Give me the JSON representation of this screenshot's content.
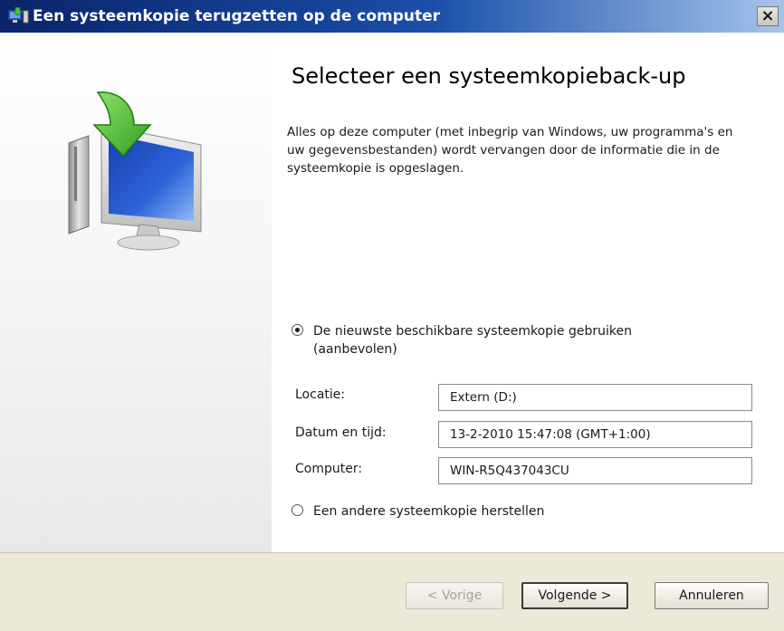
{
  "window": {
    "title": "Een systeemkopie terugzetten op de computer",
    "close_label": "×"
  },
  "main": {
    "heading": "Selecteer een systeemkopieback-up",
    "description": "Alles op deze computer (met inbegrip van Windows, uw programma's en uw gegevensbestanden) wordt vervangen door de informatie die in de systeemkopie is opgeslagen.",
    "options": {
      "latest": {
        "line1": "De nieuwste beschikbare systeemkopie gebruiken",
        "line2": "(aanbevolen)",
        "selected": true
      },
      "other": {
        "label": "Een andere systeemkopie herstellen",
        "selected": false
      }
    },
    "fields": {
      "location_label": "Locatie:",
      "location_value": "Extern (D:)",
      "datetime_label": "Datum en tijd:",
      "datetime_value": "13-2-2010 15:47:08 (GMT+1:00)",
      "computer_label": "Computer:",
      "computer_value": "WIN-R5Q437043CU"
    }
  },
  "footer": {
    "prev_label": "< Vorige",
    "next_label": "Volgende >",
    "cancel_label": "Annuleren"
  },
  "icons": {
    "title_icon": "restore-icon",
    "illustration": "monitor-with-green-arrow-icon"
  },
  "colors": {
    "titlebar_start": "#0a246a",
    "titlebar_end": "#a6c4ea",
    "footer_bg": "#ece9d8",
    "arrow_green": "#3fb52b",
    "screen_blue": "#1a3fb0"
  }
}
